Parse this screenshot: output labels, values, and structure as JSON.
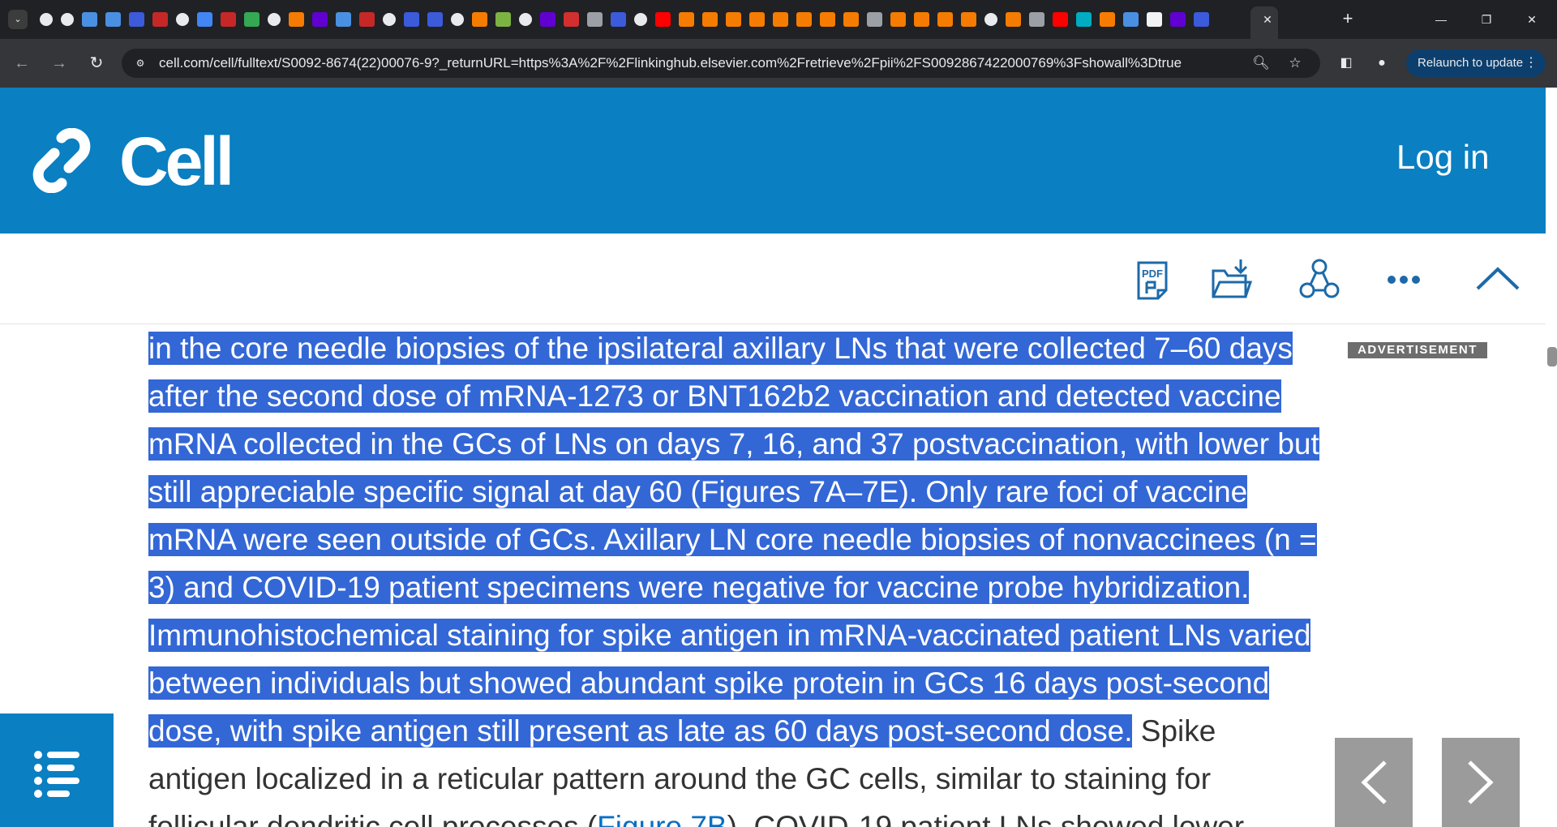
{
  "browser": {
    "menu_glyph": "⌄",
    "url": "cell.com/cell/fulltext/S0092-8674(22)00076-9?_returnURL=https%3A%2F%2Flinkinghub.elsevier.com%2Fretrieve%2Fpii%2FS0092867422000769%3Fshowall%3Dtrue",
    "relaunch_label": "Relaunch to update",
    "favicons": [
      "globe",
      "globe",
      "shield",
      "shield",
      "blue",
      "bi",
      "globe",
      "search",
      "bi",
      "play",
      "globe",
      "orange",
      "yahoo",
      "shield",
      "bi",
      "globe",
      "blue",
      "blue",
      "globe",
      "orange",
      "green",
      "globe",
      "yahoo",
      "red",
      "grey",
      "blue",
      "globe",
      "youtube",
      "orange",
      "orange",
      "orange",
      "orange",
      "orange",
      "orange",
      "orange",
      "orange",
      "grey",
      "orange",
      "orange",
      "orange",
      "orange",
      "globe",
      "orange",
      "grey",
      "youtube",
      "teal",
      "orange",
      "shield",
      "white",
      "yahoo",
      "blue"
    ],
    "colors": {
      "globe": "#e8eaed",
      "shield": "#4a90e2",
      "blue": "#3b5bdb",
      "bi": "#c62828",
      "search": "#4285f4",
      "play": "#34a853",
      "orange": "#f57c00",
      "yahoo": "#6001d2",
      "green": "#7cb342",
      "red": "#d32f2f",
      "grey": "#9aa0a6",
      "youtube": "#ff0000",
      "teal": "#00acc1",
      "white": "#f1f3f4"
    }
  },
  "site": {
    "brand": "Cell",
    "login": "Log in",
    "header_color": "#0a7fc2",
    "tools": [
      "pdf-icon",
      "download-folder-icon",
      "share-icon",
      "more-icon",
      "back-to-top-icon"
    ]
  },
  "article": {
    "lines": [
      {
        "segments": [
          {
            "t": "in the core needle biopsies of the ipsilateral axillary LNs that were collected 7–60 days",
            "hl": true
          }
        ]
      },
      {
        "segments": [
          {
            "t": "after the second dose of mRNA-1273 or BNT162b2 vaccination and detected vaccine",
            "hl": true
          }
        ]
      },
      {
        "segments": [
          {
            "t": "mRNA collected in the GCs of LNs on days 7, 16, and 37 postvaccination, with lower but",
            "hl": true
          }
        ]
      },
      {
        "segments": [
          {
            "t": "still appreciable specific signal at day 60 (",
            "hl": true
          },
          {
            "t": "Figures 7A–7E",
            "hl": true,
            "link": true
          },
          {
            "t": "). Only rare foci of vaccine",
            "hl": true
          }
        ]
      },
      {
        "segments": [
          {
            "t": "mRNA were seen outside of GCs. Axillary LN core needle biopsies of nonvaccinees (n =",
            "hl": true
          }
        ]
      },
      {
        "segments": [
          {
            "t": "3) and COVID-19 patient specimens were negative for vaccine probe hybridization.",
            "hl": true
          }
        ]
      },
      {
        "segments": [
          {
            "t": "Immunohistochemical staining for spike antigen in mRNA-vaccinated patient LNs varied",
            "hl": true
          }
        ]
      },
      {
        "segments": [
          {
            "t": "between individuals but showed abundant spike protein in GCs 16 days post-second",
            "hl": true
          }
        ]
      },
      {
        "segments": [
          {
            "t": "dose, with spike antigen still present as late as 60 days post-second dose.",
            "hl": true
          },
          {
            "t": " Spike",
            "hl": false
          }
        ]
      },
      {
        "segments": [
          {
            "t": "antigen localized in a reticular pattern around the GC cells, similar to staining for",
            "hl": false
          }
        ]
      },
      {
        "segments": [
          {
            "t": "follicular dendritic cell processes (",
            "hl": false
          },
          {
            "t": "Figure 7B",
            "hl": false,
            "link": true
          },
          {
            "t": "). COVID-19 patient LNs showed lower",
            "hl": false
          }
        ]
      }
    ],
    "advertisement_label": "ADVERTISEMENT",
    "highlight_color": "#3367d6"
  },
  "nav": {
    "prev_glyph": "‹",
    "next_glyph": "›"
  }
}
